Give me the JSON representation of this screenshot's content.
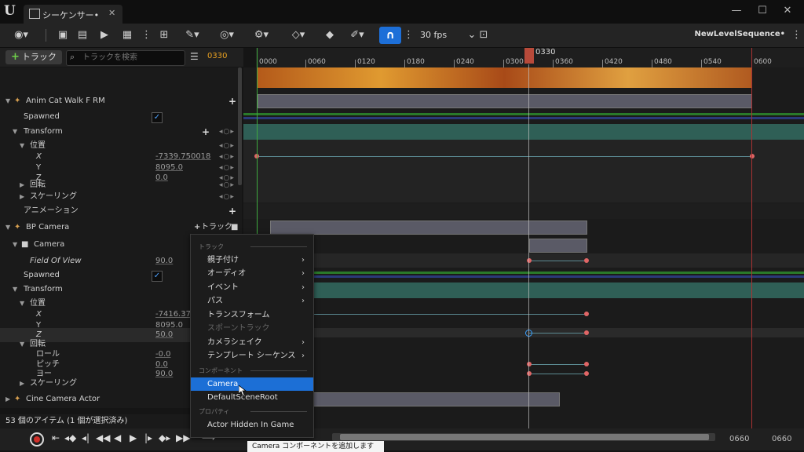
{
  "window": {
    "tab_label": "シーケンサー•",
    "minimize": "—",
    "maximize": "☐",
    "close": "✕"
  },
  "toolbar": {
    "fps": "30 fps",
    "sequence_name": "NewLevelSequence•"
  },
  "outliner": {
    "add_track_label": "トラック",
    "search_placeholder": "トラックを検索",
    "current_frame": "0330",
    "rows": [
      {
        "label": "Anim Cat Walk F RM"
      },
      {
        "label": "Spawned"
      },
      {
        "label": "Transform"
      },
      {
        "label": "位置"
      },
      {
        "label": "X",
        "value": "-7339.750018"
      },
      {
        "label": "Y",
        "value": "8095.0"
      },
      {
        "label": "Z",
        "value": "0.0"
      },
      {
        "label": "回転"
      },
      {
        "label": "スケーリング"
      },
      {
        "label": "アニメーション"
      },
      {
        "label": "BP Camera",
        "track_button": "トラック"
      },
      {
        "label": "Camera"
      },
      {
        "label": "Field Of View",
        "value": "90.0"
      },
      {
        "label": "Spawned"
      },
      {
        "label": "Transform"
      },
      {
        "label": "位置"
      },
      {
        "label": "X",
        "value": "-7416.375"
      },
      {
        "label": "Y",
        "value": "8095.0"
      },
      {
        "label": "Z",
        "value": "50.0"
      },
      {
        "label": "回転"
      },
      {
        "label": "ロール",
        "value": "-0.0"
      },
      {
        "label": "ピッチ",
        "value": "0.0"
      },
      {
        "label": "ヨー",
        "value": "90.0"
      },
      {
        "label": "スケーリング"
      },
      {
        "label": "Cine Camera Actor"
      }
    ],
    "status": "53 個のアイテム (1 個が選択済み)"
  },
  "timeline": {
    "playhead": "0330",
    "ticks": [
      "0000",
      "0060",
      "0120",
      "0180",
      "0240",
      "0300",
      "0360",
      "0420",
      "0480",
      "0540",
      "0600"
    ],
    "end_frame_a": "0660",
    "end_frame_b": "0660"
  },
  "context_menu": {
    "header_track": "トラック",
    "items_track": [
      {
        "label": "親子付け",
        "submenu": true
      },
      {
        "label": "オーディオ",
        "submenu": true
      },
      {
        "label": "イベント",
        "submenu": true
      },
      {
        "label": "パス",
        "submenu": true
      },
      {
        "label": "トランスフォーム",
        "submenu": false
      },
      {
        "label": "スポーントラック",
        "submenu": false,
        "disabled": true
      },
      {
        "label": "カメラシェイク",
        "submenu": true
      },
      {
        "label": "テンプレート シーケンス",
        "submenu": true
      }
    ],
    "header_component": "コンポーネント",
    "items_component": [
      {
        "label": "Camera",
        "highlighted": true
      },
      {
        "label": "DefaultSceneRoot"
      }
    ],
    "header_property": "プロパティ",
    "items_property": [
      {
        "label": "Actor Hidden In Game"
      }
    ]
  },
  "tooltip": "Camera コンポーネントを追加します"
}
